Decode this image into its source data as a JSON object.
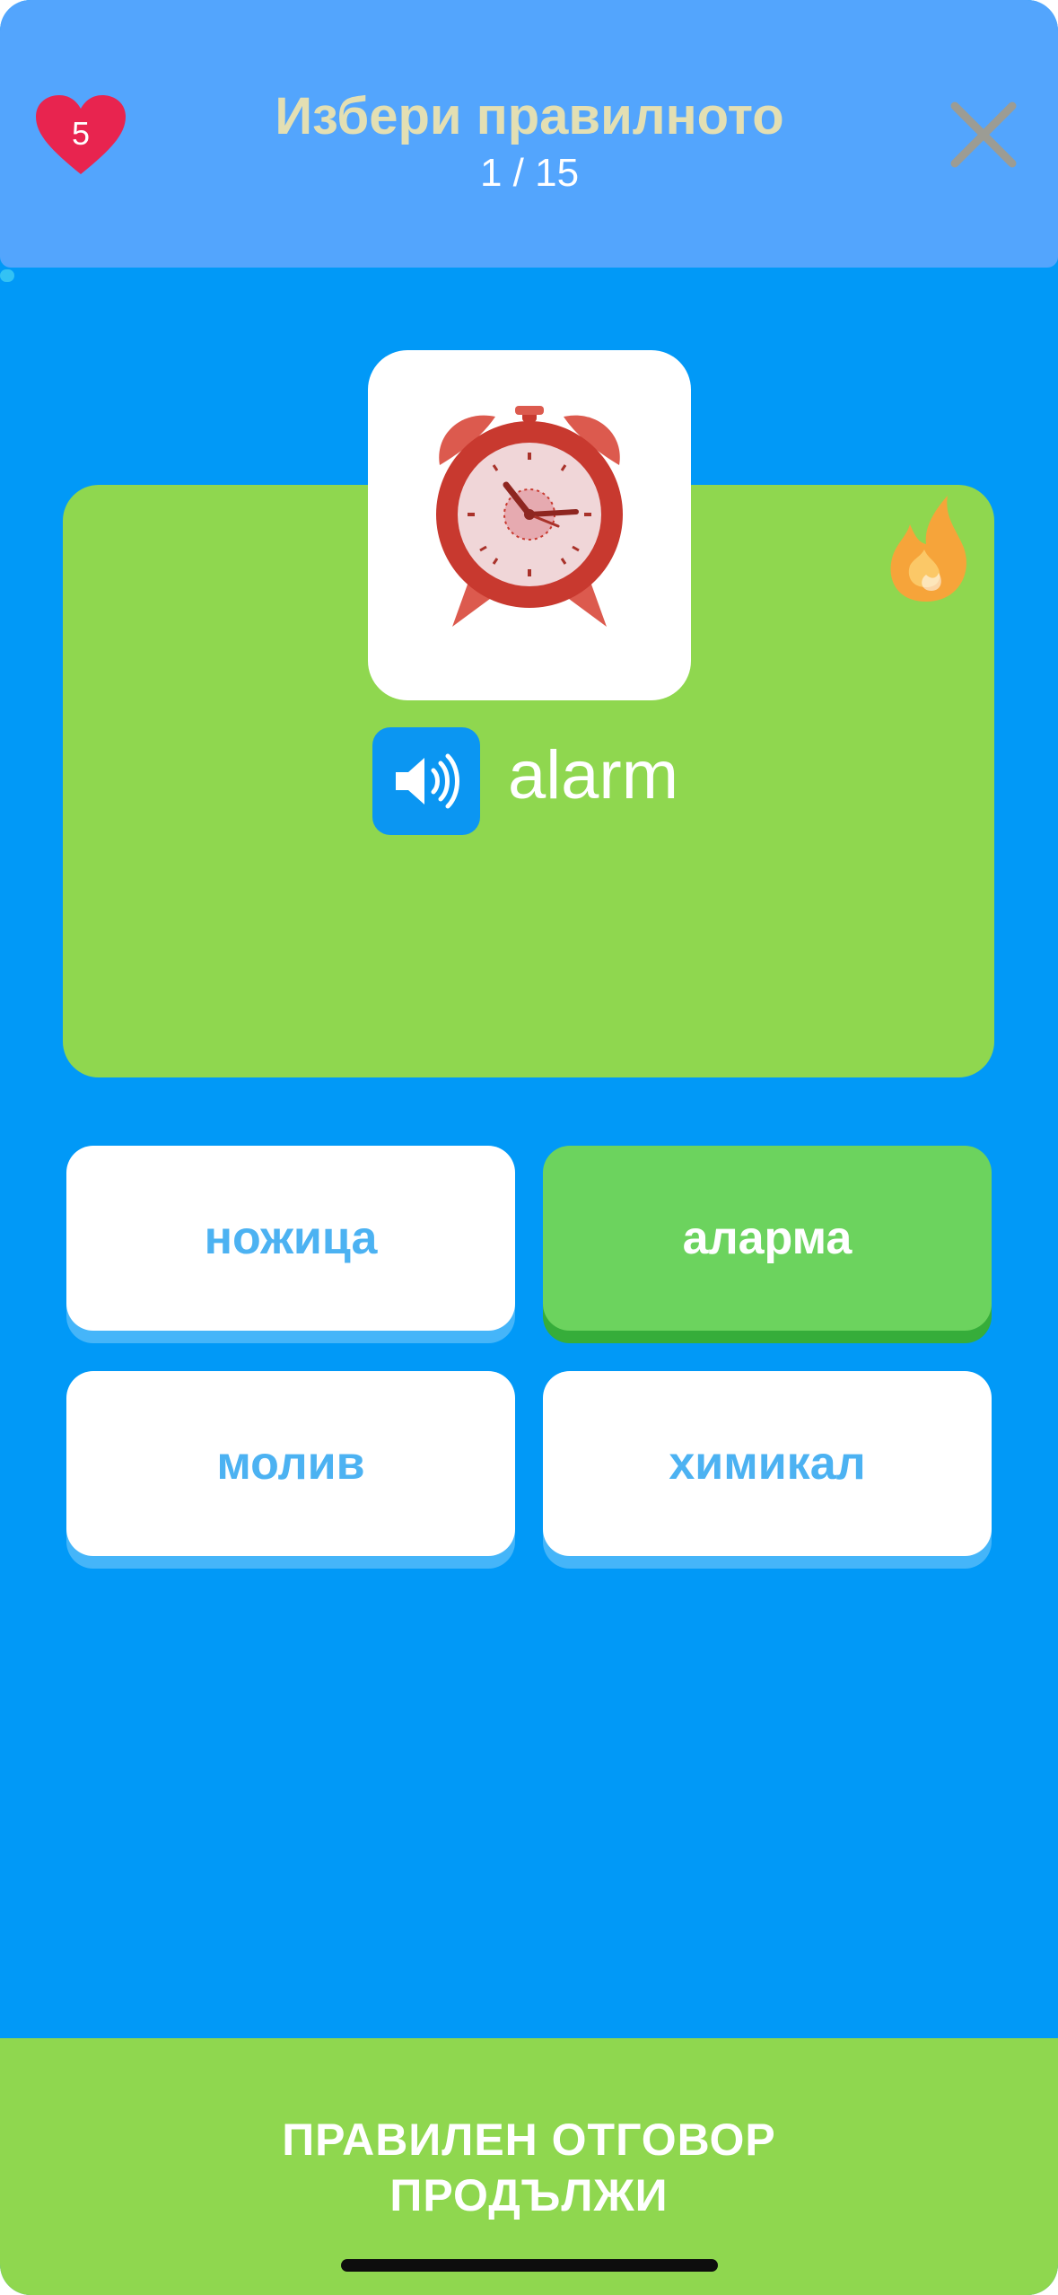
{
  "header": {
    "lives": "5",
    "title": "Избери правилното",
    "progress_text": "1 / 15",
    "progress": {
      "current": 1,
      "total": 15
    },
    "close_icon": "close-icon",
    "heart_color": "#e8244f"
  },
  "card": {
    "image_icon": "alarm-clock-icon",
    "word": "alarm",
    "speaker_icon": "speaker-icon",
    "streak_icon": "fire-icon",
    "background_color": "#8fd74f"
  },
  "options": [
    {
      "label": "ножица",
      "state": "default"
    },
    {
      "label": "аларма",
      "state": "correct"
    },
    {
      "label": "молив",
      "state": "default"
    },
    {
      "label": "химикал",
      "state": "default"
    }
  ],
  "footer": {
    "line1": "ПРАВИЛЕН ОТГОВОР",
    "line2": "ПРОДЪЛЖИ",
    "background_color": "#8fd74f"
  },
  "colors": {
    "screen_background": "#0199f7",
    "header_background": "#53a5fd",
    "correct_option": "#6cd35e",
    "option_text": "#4cb2f2"
  }
}
